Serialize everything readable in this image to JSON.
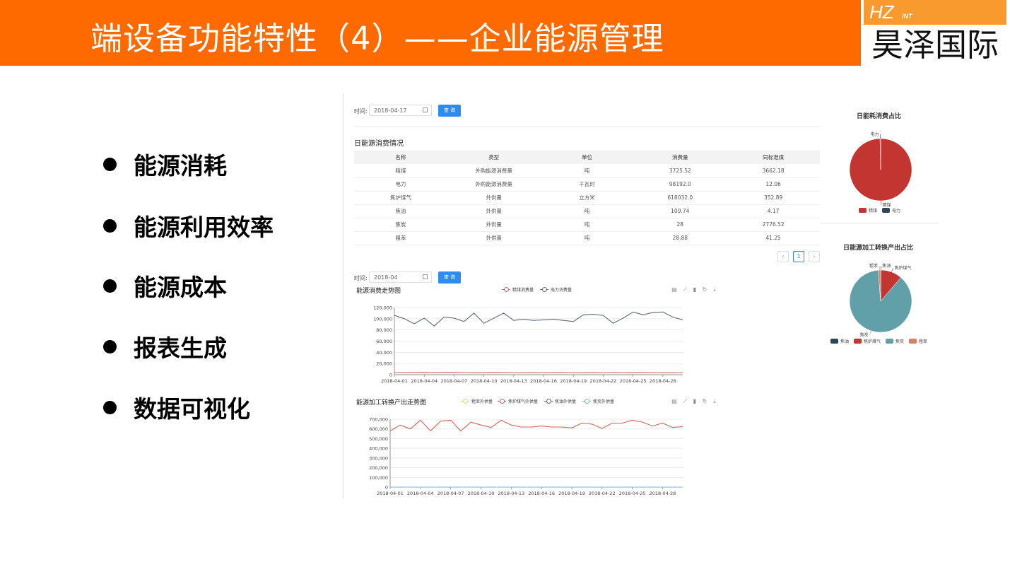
{
  "header": {
    "title": "端设备功能特性（4）——企业能源管理",
    "logo_text": "HZ",
    "logo_sub": "INT",
    "logo_cn": "昊泽国际"
  },
  "bullets": [
    "能源消耗",
    "能源利用效率",
    "能源成本",
    "报表生成",
    "数据可视化"
  ],
  "dashboard": {
    "time_label_1": "时间:",
    "date_1": "2018-04-17",
    "query_label_1": "查 询",
    "table_title": "日能源消费情况",
    "columns": [
      "名称",
      "类型",
      "单位",
      "消费量",
      "同标准煤"
    ],
    "rows": [
      [
        "精煤",
        "外购能源消费量",
        "吨",
        "3725.52",
        "3662.18"
      ],
      [
        "电力",
        "外购能源消费量",
        "千瓦时",
        "98192.0",
        "12.06"
      ],
      [
        "焦炉煤气",
        "外供量",
        "立方米",
        "618032.0",
        "352.89"
      ],
      [
        "焦油",
        "外供量",
        "吨",
        "109.74",
        "4.17"
      ],
      [
        "焦炭",
        "外供量",
        "吨",
        "28",
        "2776.52"
      ],
      [
        "粗苯",
        "外供量",
        "吨",
        "28.88",
        "41.25"
      ]
    ],
    "pager": {
      "prev": "‹",
      "page": "1",
      "next": "›"
    },
    "time_label_2": "时间:",
    "date_2": "2018-04",
    "query_label_2": "查 询"
  },
  "toolbar_icons": [
    "data-view-icon",
    "line-switch-icon",
    "bar-switch-icon",
    "restore-icon",
    "download-icon"
  ],
  "chart_data": [
    {
      "type": "line",
      "title": "能源消费走势图",
      "x": [
        "2018-04-01",
        "2018-04-02",
        "2018-04-03",
        "2018-04-04",
        "2018-04-05",
        "2018-04-06",
        "2018-04-07",
        "2018-04-08",
        "2018-04-09",
        "2018-04-10",
        "2018-04-11",
        "2018-04-12",
        "2018-04-13",
        "2018-04-14",
        "2018-04-15",
        "2018-04-16",
        "2018-04-17",
        "2018-04-18",
        "2018-04-19",
        "2018-04-20",
        "2018-04-21",
        "2018-04-22",
        "2018-04-23",
        "2018-04-24",
        "2018-04-25",
        "2018-04-26",
        "2018-04-27",
        "2018-04-28",
        "2018-04-29",
        "2018-04-30"
      ],
      "xticks": [
        "2018-04-01",
        "2018-04-04",
        "2018-04-07",
        "2018-04-10",
        "2018-04-13",
        "2018-04-16",
        "2018-04-19",
        "2018-04-22",
        "2018-04-25",
        "2018-04-28"
      ],
      "ylim": [
        0,
        120000
      ],
      "yticks": [
        "0",
        "20,000",
        "40,000",
        "60,000",
        "80,000",
        "100,000",
        "120,000"
      ],
      "legend_position": "top-center",
      "grid": true,
      "series": [
        {
          "name": "精煤消费量",
          "color": "#d0645b",
          "values": [
            3800,
            3700,
            3900,
            4100,
            3700,
            3900,
            4000,
            3800,
            3600,
            3700,
            3900,
            3700,
            3800,
            3600,
            3700,
            3800,
            3700,
            3900,
            3800,
            3600,
            3700,
            3800,
            3900,
            3800,
            3700,
            3900,
            3800,
            3700,
            3600,
            3800
          ]
        },
        {
          "name": "电力消费量",
          "color": "#5b6b7a",
          "values": [
            106000,
            100000,
            91000,
            101000,
            87000,
            103000,
            101000,
            95000,
            110000,
            92000,
            101000,
            110000,
            97000,
            99000,
            97000,
            98000,
            99000,
            97000,
            95000,
            107000,
            108000,
            106000,
            92000,
            101000,
            112000,
            107000,
            111000,
            112000,
            103000,
            98000
          ]
        }
      ]
    },
    {
      "type": "line",
      "title": "能源加工转换产出走势图",
      "x": [
        "2018-04-01",
        "2018-04-02",
        "2018-04-03",
        "2018-04-04",
        "2018-04-05",
        "2018-04-06",
        "2018-04-07",
        "2018-04-08",
        "2018-04-09",
        "2018-04-10",
        "2018-04-11",
        "2018-04-12",
        "2018-04-13",
        "2018-04-14",
        "2018-04-15",
        "2018-04-16",
        "2018-04-17",
        "2018-04-18",
        "2018-04-19",
        "2018-04-20",
        "2018-04-21",
        "2018-04-22",
        "2018-04-23",
        "2018-04-24",
        "2018-04-25",
        "2018-04-26",
        "2018-04-27",
        "2018-04-28",
        "2018-04-29",
        "2018-04-30"
      ],
      "xticks": [
        "2018-04-01",
        "2018-04-04",
        "2018-04-07",
        "2018-04-10",
        "2018-04-13",
        "2018-04-16",
        "2018-04-19",
        "2018-04-22",
        "2018-04-25",
        "2018-04-28"
      ],
      "ylim": [
        0,
        700000
      ],
      "yticks": [
        "0",
        "100,000",
        "200,000",
        "300,000",
        "400,000",
        "500,000",
        "600,000",
        "700,000"
      ],
      "legend_position": "top-center",
      "grid": true,
      "series": [
        {
          "name": "粗苯外供量",
          "color": "#f5cf56",
          "values": [
            29,
            28,
            30,
            29,
            28,
            30,
            29,
            28,
            29,
            30,
            29,
            28,
            29,
            30,
            28,
            29,
            30,
            29,
            28,
            29,
            30,
            29,
            28,
            29,
            30,
            29,
            28,
            29,
            30,
            29
          ]
        },
        {
          "name": "焦炉煤气外供量",
          "color": "#d0645b",
          "values": [
            580000,
            640000,
            600000,
            690000,
            580000,
            680000,
            690000,
            580000,
            670000,
            640000,
            615000,
            690000,
            640000,
            620000,
            620000,
            630000,
            620000,
            620000,
            610000,
            660000,
            650000,
            605000,
            660000,
            660000,
            690000,
            670000,
            630000,
            660000,
            615000,
            625000
          ]
        },
        {
          "name": "焦油外供量",
          "color": "#5b6b7a",
          "values": [
            110,
            108,
            112,
            109,
            111,
            110,
            108,
            109,
            110,
            112,
            111,
            109,
            110,
            108,
            109,
            110,
            111,
            109,
            110,
            108,
            109,
            110,
            111,
            110,
            109,
            108,
            110,
            111,
            109,
            110
          ]
        },
        {
          "name": "焦炭外供量",
          "color": "#7ab2d8",
          "values": [
            28,
            28,
            28,
            28,
            28,
            28,
            28,
            28,
            28,
            28,
            28,
            28,
            28,
            28,
            28,
            28,
            28,
            28,
            28,
            28,
            28,
            28,
            28,
            28,
            28,
            28,
            28,
            28,
            28,
            28
          ]
        }
      ]
    },
    {
      "type": "pie",
      "title": "日能耗消费占比",
      "legend_position": "bottom",
      "series": [
        {
          "name": "精煤",
          "color": "#c23531",
          "value": 3662.18
        },
        {
          "name": "电力",
          "color": "#2f4554",
          "value": 12.06
        }
      ]
    },
    {
      "type": "pie",
      "title": "日能源加工转换产出占比",
      "legend_position": "bottom",
      "series": [
        {
          "name": "焦油",
          "color": "#2f4554",
          "value": 4.17
        },
        {
          "name": "焦炉煤气",
          "color": "#c23531",
          "value": 352.89
        },
        {
          "name": "焦炭",
          "color": "#61a0a8",
          "value": 2776.52
        },
        {
          "name": "粗苯",
          "color": "#d48265",
          "value": 41.25
        }
      ]
    }
  ]
}
